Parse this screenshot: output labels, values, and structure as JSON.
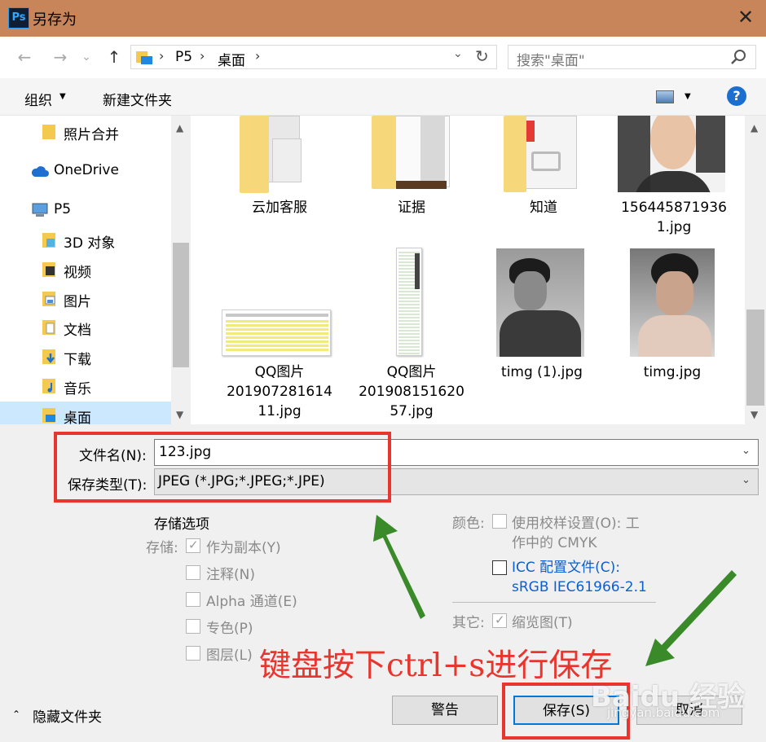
{
  "window": {
    "title": "另存为",
    "app_badge": "Ps",
    "close_glyph": "✕"
  },
  "nav": {
    "back": "←",
    "forward": "→",
    "history": "⌄",
    "up": "↑"
  },
  "address": {
    "crumbs": [
      "P5",
      "桌面"
    ],
    "sep": "›",
    "dropdown": "⌄",
    "refresh": "↻"
  },
  "search": {
    "placeholder": "搜索\"桌面\""
  },
  "toolbar": {
    "organize": "组织",
    "caret": "▼",
    "new_folder": "新建文件夹",
    "help": "?"
  },
  "sidebar": {
    "items": [
      {
        "label": "照片合并",
        "icon": "folder-icon"
      },
      {
        "label": "OneDrive",
        "icon": "cloud-icon"
      },
      {
        "label": "P5",
        "icon": "computer-icon"
      },
      {
        "label": "3D 对象",
        "icon": "3d-objects-icon"
      },
      {
        "label": "视频",
        "icon": "video-icon"
      },
      {
        "label": "图片",
        "icon": "pictures-icon"
      },
      {
        "label": "文档",
        "icon": "documents-icon"
      },
      {
        "label": "下载",
        "icon": "download-icon"
      },
      {
        "label": "音乐",
        "icon": "music-icon"
      },
      {
        "label": "桌面",
        "icon": "desktop-icon",
        "selected": true
      }
    ]
  },
  "files": [
    {
      "name": "云加客服",
      "type": "folder"
    },
    {
      "name": "证据",
      "type": "folder"
    },
    {
      "name": "知道",
      "type": "folder"
    },
    {
      "name_lines": [
        "156445871936",
        "1.jpg"
      ],
      "type": "image"
    },
    {
      "name_lines": [
        "QQ图片",
        "201907281614",
        "11.jpg"
      ],
      "type": "image"
    },
    {
      "name_lines": [
        "QQ图片",
        "201908151620",
        "57.jpg"
      ],
      "type": "image"
    },
    {
      "name": "timg (1).jpg",
      "type": "image"
    },
    {
      "name": "timg.jpg",
      "type": "image"
    }
  ],
  "form": {
    "filename_label": "文件名(N):",
    "filename_value": "123.jpg",
    "filetype_label": "保存类型(T):",
    "filetype_value": "JPEG (*.JPG;*.JPEG;*.JPE)",
    "dropdown": "⌄"
  },
  "save_options": {
    "title": "存储选项",
    "save_label": "存储:",
    "options": [
      {
        "label": "作为副本(Y)",
        "checked": true
      },
      {
        "label": "注释(N)",
        "checked": false
      },
      {
        "label": "Alpha 通道(E)",
        "checked": false
      },
      {
        "label": "专色(P)",
        "checked": false
      },
      {
        "label": "图层(L)",
        "checked": false
      }
    ],
    "color_label": "颜色:",
    "proof_line1": "使用校样设置(O): 工",
    "proof_line2": "作中的 CMYK",
    "icc_line1": "ICC 配置文件(C):",
    "icc_line2": "sRGB IEC61966-2.1",
    "other_label": "其它:",
    "thumbnail": "缩览图(T)"
  },
  "footer": {
    "hide_folders": "隐藏文件夹",
    "hide_caret": "⌃",
    "warning": "警告",
    "save": "保存(S)",
    "cancel": "取消"
  },
  "annotation": {
    "text": "键盘按下ctrl+s进行保存",
    "watermark": "Baidu 经验",
    "watermark_sub": "jingyan.baidu.com",
    "accent": "#e8352e",
    "arrow_color": "#3a8a2a"
  }
}
